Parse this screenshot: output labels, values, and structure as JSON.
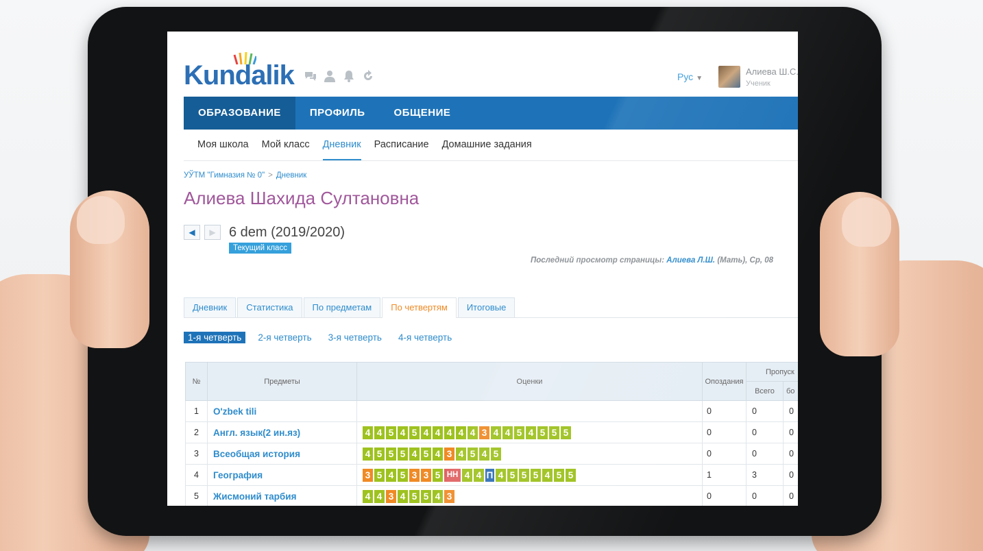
{
  "header": {
    "logo_text": "Kundalik",
    "lang": "Рус",
    "user_name": "Алиева Ш.С.",
    "user_role": "Ученик",
    "icons": [
      "chat-icon",
      "user-icon",
      "bell-icon",
      "refresh-icon"
    ]
  },
  "main_nav": [
    "ОБРАЗОВАНИЕ",
    "ПРОФИЛЬ",
    "ОБЩЕНИЕ"
  ],
  "sub_nav": [
    "Моя школа",
    "Мой класс",
    "Дневник",
    "Расписание",
    "Домашние задания"
  ],
  "breadcrumb": {
    "school": "УЎТМ \"Гимназия № 0\"",
    "sep": ">",
    "page": "Дневник"
  },
  "page_title": "Алиева Шахида Султановна",
  "klass": {
    "name": "6 dem (2019/2020)",
    "badge": "Текущий класс"
  },
  "last_view": {
    "prefix": "Последний просмотр страницы:",
    "who": "Алиева Л.Ш.",
    "suffix": "(Мать), Ср, 08"
  },
  "tabs": [
    "Дневник",
    "Статистика",
    "По предметам",
    "По четвертям",
    "Итоговые"
  ],
  "quarters": [
    "1-я четверть",
    "2-я четверть",
    "3-я четверть",
    "4-я четверть"
  ],
  "table": {
    "headers": {
      "num": "№",
      "subjects": "Предметы",
      "grades": "Оценки",
      "late": "Опоздания",
      "absences": "Пропуск",
      "total": "Всего",
      "sick": "бо"
    },
    "rows": [
      {
        "num": "1",
        "subject": "O'zbek tili",
        "grades": [],
        "late": "0",
        "total": "0",
        "sick": "0"
      },
      {
        "num": "2",
        "subject": "Англ. язык(2 ин.яз)",
        "grades": [
          "4",
          "4",
          "5",
          "4",
          "5",
          "4",
          "4",
          "4",
          "4",
          "4",
          "3",
          "4",
          "4",
          "5",
          "4",
          "5",
          "5",
          "5"
        ],
        "late": "0",
        "total": "0",
        "sick": "0"
      },
      {
        "num": "3",
        "subject": "Всеобщая история",
        "grades": [
          "4",
          "5",
          "5",
          "5",
          "4",
          "5",
          "4",
          "3",
          "4",
          "5",
          "4",
          "5"
        ],
        "late": "0",
        "total": "0",
        "sick": "0"
      },
      {
        "num": "4",
        "subject": "География",
        "grades": [
          "3",
          "5",
          "4",
          "5",
          "3",
          "3",
          "5",
          "НН",
          "4",
          "4",
          "П",
          "4",
          "5",
          "5",
          "5",
          "4",
          "5",
          "5"
        ],
        "late": "1",
        "total": "3",
        "sick": "0"
      },
      {
        "num": "5",
        "subject": "Жисмоний тарбия",
        "grades": [
          "4",
          "4",
          "3",
          "4",
          "5",
          "5",
          "4",
          "3"
        ],
        "late": "0",
        "total": "0",
        "sick": "0"
      }
    ]
  },
  "colors": {
    "nav_blue": "#1e73b8",
    "title_purple": "#a0579b",
    "grade_good": "#9ec21f",
    "grade_three": "#ef8a25",
    "grade_absent": "#e06060",
    "grade_pass": "#2f6fb5",
    "tab_active": "#ef8a25"
  }
}
